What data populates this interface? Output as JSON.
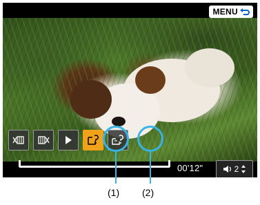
{
  "menu": {
    "label": "MENU"
  },
  "controls": [
    {
      "name": "trim-start-icon",
      "active": false
    },
    {
      "name": "trim-end-icon",
      "active": false
    },
    {
      "name": "play-icon",
      "active": false
    },
    {
      "name": "save-icon",
      "active": true
    },
    {
      "name": "save-compressed-icon",
      "active": false
    }
  ],
  "playback": {
    "elapsed": "00'12\"",
    "progress": 1.0
  },
  "volume": {
    "level": "2"
  },
  "callouts": [
    {
      "label": "(1)"
    },
    {
      "label": "(2)"
    }
  ],
  "colors": {
    "active": "#f0a21a",
    "callout": "#38b3e8"
  }
}
